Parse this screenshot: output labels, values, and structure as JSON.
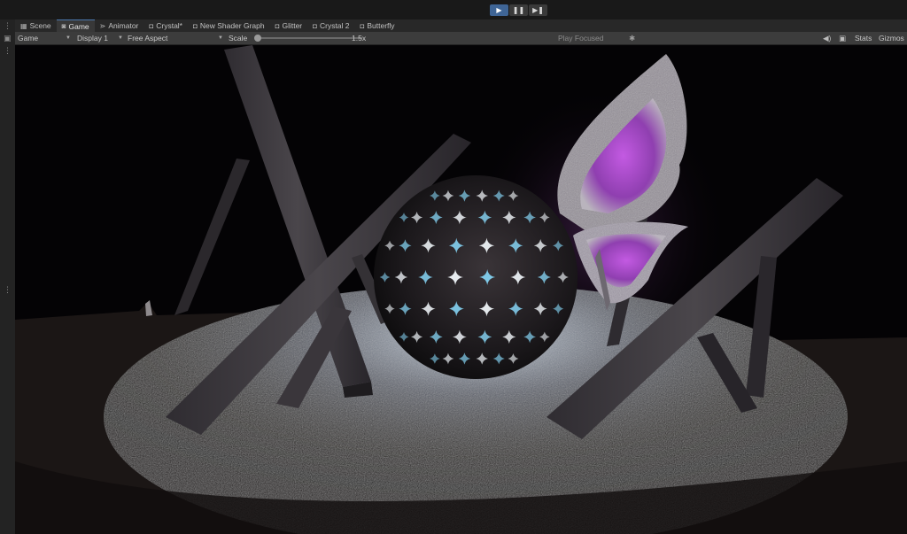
{
  "play_controls": {
    "play_label": "▶",
    "pause_label": "❚❚",
    "step_label": "▶❚"
  },
  "tabs": [
    {
      "label": "Scene",
      "icon": "grid-icon",
      "glyph": "▦"
    },
    {
      "label": "Game",
      "icon": "gamepad-icon",
      "glyph": "◙",
      "active": true
    },
    {
      "label": "Animator",
      "icon": "animator-icon",
      "glyph": "⋗"
    },
    {
      "label": "Crystal*",
      "icon": "shader-icon",
      "glyph": "◘"
    },
    {
      "label": "New Shader Graph",
      "icon": "shader-icon",
      "glyph": "◘"
    },
    {
      "label": "Glitter",
      "icon": "shader-icon",
      "glyph": "◘"
    },
    {
      "label": "Crystal 2",
      "icon": "shader-icon",
      "glyph": "◘"
    },
    {
      "label": "Butterfly",
      "icon": "shader-icon",
      "glyph": "◘"
    }
  ],
  "toolbar": {
    "view_mode": "Game",
    "display": "Display 1",
    "aspect": "Free Aspect",
    "scale_label": "Scale",
    "scale_value": "1.5x",
    "play_mode": "Play Focused",
    "stats_label": "Stats",
    "gizmos_label": "Gizmos"
  },
  "icons": {
    "more": "more-options-icon",
    "bug": "bug-icon",
    "audio": "audio-mute-icon",
    "gallery": "gallery-icon"
  },
  "colors": {
    "accent": "#3f6596",
    "tab_active_border": "#4d79b0",
    "butterfly": "#b24fd4"
  }
}
